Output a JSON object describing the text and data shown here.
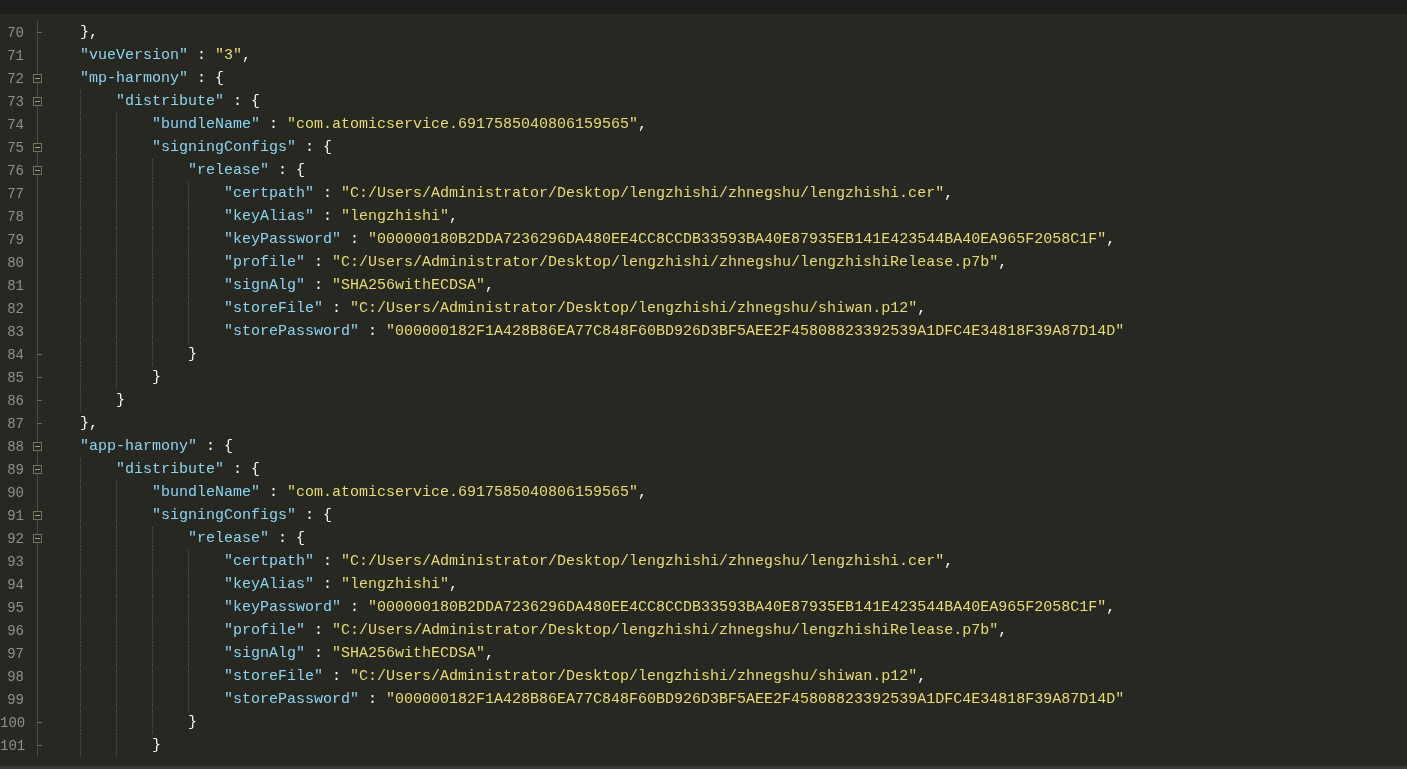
{
  "lines": [
    {
      "line": "70",
      "kind": "close",
      "tail": "},"
    },
    {
      "line": "71",
      "kind": "entry",
      "key": "\"vueVersion\"",
      "sep": " : ",
      "value": "\"3\"",
      "tail": ","
    },
    {
      "line": "72",
      "kind": "open",
      "expanded": true,
      "key": "\"mp-harmony\"",
      "sep": " : ",
      "tail": "{",
      "children": [
        {
          "line": "73",
          "kind": "open",
          "expanded": true,
          "key": "\"distribute\"",
          "sep": " : ",
          "tail": "{",
          "children": [
            {
              "line": "74",
              "kind": "entry",
              "key": "\"bundleName\"",
              "sep": " : ",
              "value": "\"com.atomicservice.6917585040806159565\"",
              "tail": ","
            },
            {
              "line": "75",
              "kind": "open",
              "expanded": true,
              "key": "\"signingConfigs\"",
              "sep": " : ",
              "tail": "{",
              "children": [
                {
                  "line": "76",
                  "kind": "open",
                  "expanded": true,
                  "key": "\"release\"",
                  "sep": " : ",
                  "tail": "{",
                  "children": [
                    {
                      "line": "77",
                      "kind": "entry",
                      "key": "\"certpath\"",
                      "sep": " : ",
                      "value": "\"C:/Users/Administrator/Desktop/lengzhishi/zhnegshu/lengzhishi.cer\"",
                      "tail": ","
                    },
                    {
                      "line": "78",
                      "kind": "entry",
                      "key": "\"keyAlias\"",
                      "sep": " : ",
                      "value": "\"lengzhishi\"",
                      "tail": ","
                    },
                    {
                      "line": "79",
                      "kind": "entry",
                      "key": "\"keyPassword\"",
                      "sep": " : ",
                      "value": "\"000000180B2DDA7236296DA480EE4CC8CCDB33593BA40E87935EB141E423544BA40EA965F2058C1F\"",
                      "tail": ","
                    },
                    {
                      "line": "80",
                      "kind": "entry",
                      "key": "\"profile\"",
                      "sep": " : ",
                      "value": "\"C:/Users/Administrator/Desktop/lengzhishi/zhnegshu/lengzhishiRelease.p7b\"",
                      "tail": ","
                    },
                    {
                      "line": "81",
                      "kind": "entry",
                      "key": "\"signAlg\"",
                      "sep": " : ",
                      "value": "\"SHA256withECDSA\"",
                      "tail": ","
                    },
                    {
                      "line": "82",
                      "kind": "entry",
                      "key": "\"storeFile\"",
                      "sep": " : ",
                      "value": "\"C:/Users/Administrator/Desktop/lengzhishi/zhnegshu/shiwan.p12\"",
                      "tail": ","
                    },
                    {
                      "line": "83",
                      "kind": "entry",
                      "key": "\"storePassword\"",
                      "sep": " : ",
                      "value": "\"000000182F1A428B86EA77C848F60BD926D3BF5AEE2F45808823392539A1DFC4E34818F39A87D14D\""
                    }
                  ]
                },
                {
                  "line": "84",
                  "kind": "close",
                  "tail": "}"
                }
              ]
            },
            {
              "line": "85",
              "kind": "close",
              "tail": "}"
            }
          ]
        },
        {
          "line": "86",
          "kind": "close",
          "tail": "}"
        }
      ]
    },
    {
      "line": "87",
      "kind": "close",
      "tail": "},"
    },
    {
      "line": "88",
      "kind": "open",
      "expanded": true,
      "key": "\"app-harmony\"",
      "sep": " : ",
      "tail": "{",
      "children": [
        {
          "line": "89",
          "kind": "open",
          "expanded": true,
          "key": "\"distribute\"",
          "sep": " : ",
          "tail": "{",
          "children": [
            {
              "line": "90",
              "kind": "entry",
              "key": "\"bundleName\"",
              "sep": " : ",
              "value": "\"com.atomicservice.6917585040806159565\"",
              "tail": ","
            },
            {
              "line": "91",
              "kind": "open",
              "expanded": true,
              "key": "\"signingConfigs\"",
              "sep": " : ",
              "tail": "{",
              "children": [
                {
                  "line": "92",
                  "kind": "open",
                  "expanded": true,
                  "key": "\"release\"",
                  "sep": " : ",
                  "tail": "{",
                  "children": [
                    {
                      "line": "93",
                      "kind": "entry",
                      "key": "\"certpath\"",
                      "sep": " : ",
                      "value": "\"C:/Users/Administrator/Desktop/lengzhishi/zhnegshu/lengzhishi.cer\"",
                      "tail": ","
                    },
                    {
                      "line": "94",
                      "kind": "entry",
                      "key": "\"keyAlias\"",
                      "sep": " : ",
                      "value": "\"lengzhishi\"",
                      "tail": ","
                    },
                    {
                      "line": "95",
                      "kind": "entry",
                      "key": "\"keyPassword\"",
                      "sep": " : ",
                      "value": "\"000000180B2DDA7236296DA480EE4CC8CCDB33593BA40E87935EB141E423544BA40EA965F2058C1F\"",
                      "tail": ","
                    },
                    {
                      "line": "96",
                      "kind": "entry",
                      "key": "\"profile\"",
                      "sep": " : ",
                      "value": "\"C:/Users/Administrator/Desktop/lengzhishi/zhnegshu/lengzhishiRelease.p7b\"",
                      "tail": ","
                    },
                    {
                      "line": "97",
                      "kind": "entry",
                      "key": "\"signAlg\"",
                      "sep": " : ",
                      "value": "\"SHA256withECDSA\"",
                      "tail": ","
                    },
                    {
                      "line": "98",
                      "kind": "entry",
                      "key": "\"storeFile\"",
                      "sep": " : ",
                      "value": "\"C:/Users/Administrator/Desktop/lengzhishi/zhnegshu/shiwan.p12\"",
                      "tail": ","
                    },
                    {
                      "line": "99",
                      "kind": "entry",
                      "key": "\"storePassword\"",
                      "sep": " : ",
                      "value": "\"000000182F1A428B86EA77C848F60BD926D3BF5AEE2F45808823392539A1DFC4E34818F39A87D14D\""
                    }
                  ]
                },
                {
                  "line": "100",
                  "kind": "close",
                  "tail": "}"
                }
              ]
            },
            {
              "line": "101",
              "kind": "close",
              "tail": "}"
            }
          ]
        }
      ]
    }
  ]
}
